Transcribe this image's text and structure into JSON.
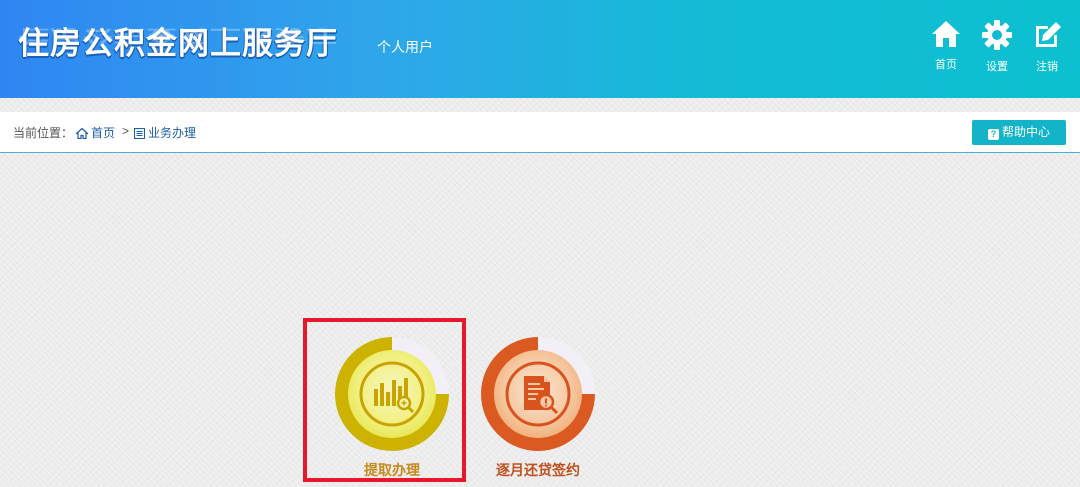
{
  "header": {
    "title": "住房公积金网上服务厅",
    "user_type": "个人用户",
    "nav": [
      {
        "label": "首页",
        "icon": "home-icon"
      },
      {
        "label": "设置",
        "icon": "gear-icon"
      },
      {
        "label": "注销",
        "icon": "edit-icon"
      }
    ]
  },
  "breadcrumb": {
    "prefix": "当前位置：",
    "items": [
      {
        "label": "首页",
        "icon": "home-icon"
      },
      {
        "label": "业务办理",
        "icon": "list-icon"
      }
    ],
    "separator": ">"
  },
  "help_button": {
    "label": "帮助中心",
    "icon": "question-icon"
  },
  "tiles": [
    {
      "label": "提取办理",
      "icon": "bar-chart-search-icon",
      "color": "#c9a400",
      "label_color": "#c78a1c"
    },
    {
      "label": "逐月还贷签约",
      "icon": "document-search-icon",
      "color": "#d9531e",
      "label_color": "#c0501e"
    }
  ],
  "colors": {
    "header_start": "#2f86f2",
    "header_end": "#0cc0cf",
    "accent": "#14b4c8",
    "highlight": "#e8182b"
  }
}
